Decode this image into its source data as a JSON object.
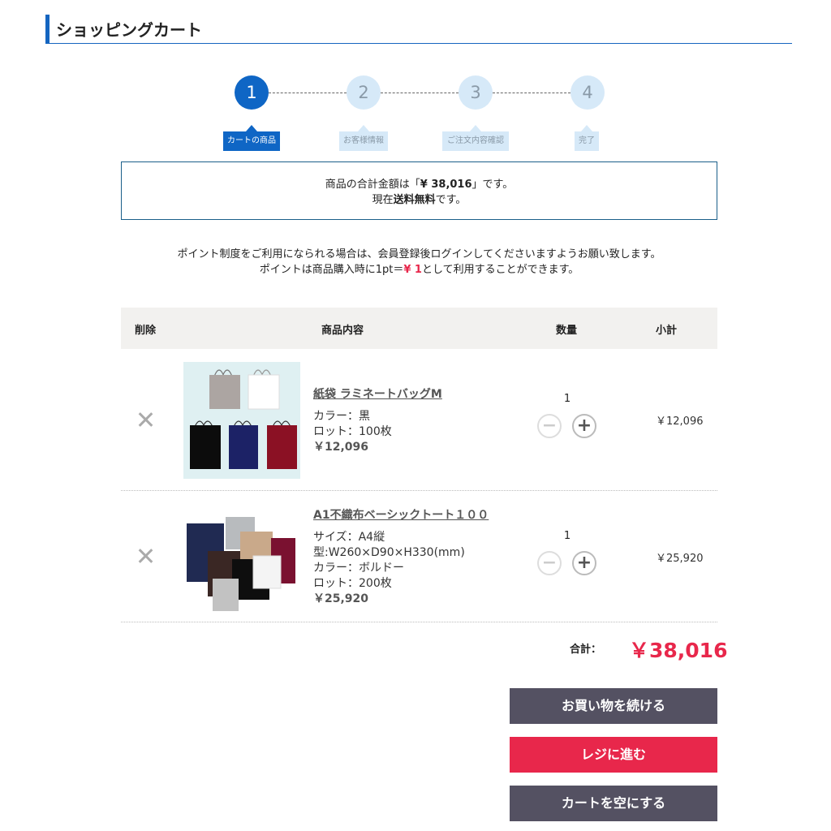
{
  "header": {
    "title": "ショッピングカート"
  },
  "steps": [
    {
      "number": "1",
      "label": "カートの商品",
      "active": true
    },
    {
      "number": "2",
      "label": "お客様情報",
      "active": false
    },
    {
      "number": "3",
      "label": "ご注文内容確認",
      "active": false
    },
    {
      "number": "4",
      "label": "完了",
      "active": false
    }
  ],
  "summary": {
    "line1_prefix": "商品の合計金額は「",
    "line1_amount": "¥ 38,016",
    "line1_suffix": "」です。",
    "line2_prefix": "現在",
    "line2_bold": "送料無料",
    "line2_suffix": "です。"
  },
  "notice": {
    "line1": "ポイント制度をご利用になられる場合は、会員登録後ログインしてくださいますようお願い致します。",
    "line2_prefix": "ポイントは商品購入時に1pt＝",
    "line2_value": "¥ 1",
    "line2_suffix": "として利用することができます。"
  },
  "table": {
    "headers": {
      "delete": "削除",
      "product": "商品内容",
      "quantity": "数量",
      "subtotal": "小計"
    },
    "rows": [
      {
        "name": "紙袋 ラミネートバッグM",
        "details": [
          "カラー：黒",
          "ロット：100枚"
        ],
        "price": "￥12,096",
        "quantity": "1",
        "subtotal": "￥12,096",
        "image_labels": [
          "シルバー",
          "白",
          "黒",
          "紺",
          "赤"
        ]
      },
      {
        "name": "A1不織布ベーシックトート１００",
        "details": [
          "サイズ：A4縦",
          "型:W260×D90×H330(mm)",
          "カラー：ボルドー",
          "ロット：200枚"
        ],
        "price": "￥25,920",
        "quantity": "1",
        "subtotal": "￥25,920",
        "image_labels": [
          "グレイ",
          "ベージュ",
          "紺",
          "ボルドー",
          "ダーク ブラウン",
          "グレイ"
        ]
      }
    ]
  },
  "total": {
    "label": "合計：",
    "value": "￥38,016"
  },
  "buttons": {
    "continue": "お買い物を続ける",
    "checkout": "レジに進む",
    "empty": "カートを空にする"
  },
  "colors": {
    "accent_blue": "#0f66c5",
    "accent_red": "#e8274b",
    "button_dark": "#545162"
  },
  "icons": {
    "delete": "close-icon",
    "minus": "minus-icon",
    "plus": "plus-icon"
  }
}
